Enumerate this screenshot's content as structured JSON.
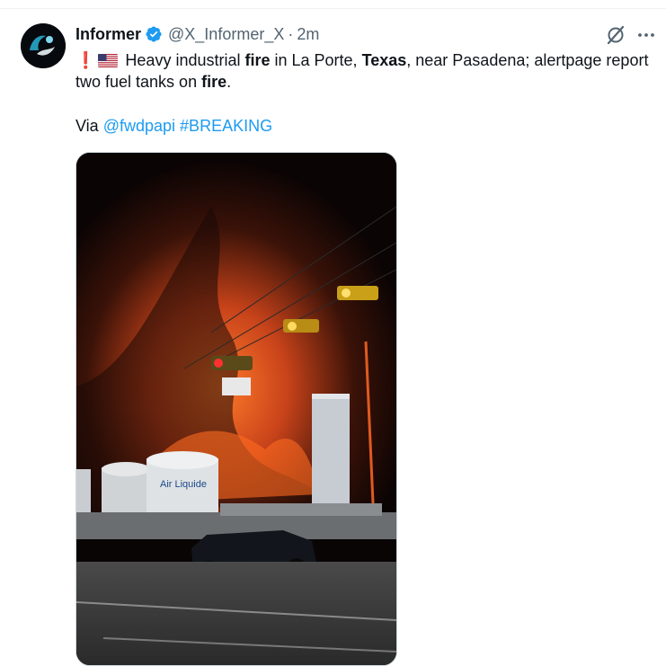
{
  "tweet": {
    "author": {
      "display_name": "Informer",
      "handle": "@X_Informer_X",
      "separator": "·",
      "time": "2m",
      "verified_icon": "verified-badge-icon",
      "avatar_icon": "avatar-image"
    },
    "text": {
      "prefix_emoji": "❗",
      "flag_emoji": "🇺🇸",
      "segment_1": " Heavy industrial ",
      "bold_1": "fire",
      "segment_2": " in La Porte, ",
      "bold_2": "Texas",
      "segment_3": ", near Pasadena; alertpage report two fuel tanks on ",
      "bold_3": "fire",
      "segment_4": "."
    },
    "via": {
      "label": "Via ",
      "mention": "@fwdpapi",
      "hashtag": "#BREAKING"
    },
    "media": {
      "sign_text": "Air Liquide",
      "description_icon": "video-thumbnail"
    },
    "actions": {
      "grok_icon": "grok-icon",
      "more_icon": "more-icon"
    }
  },
  "colors": {
    "link": "#1d9bf0",
    "muted": "#536471",
    "text": "#0f1419",
    "verified": "#1d9bf0"
  }
}
